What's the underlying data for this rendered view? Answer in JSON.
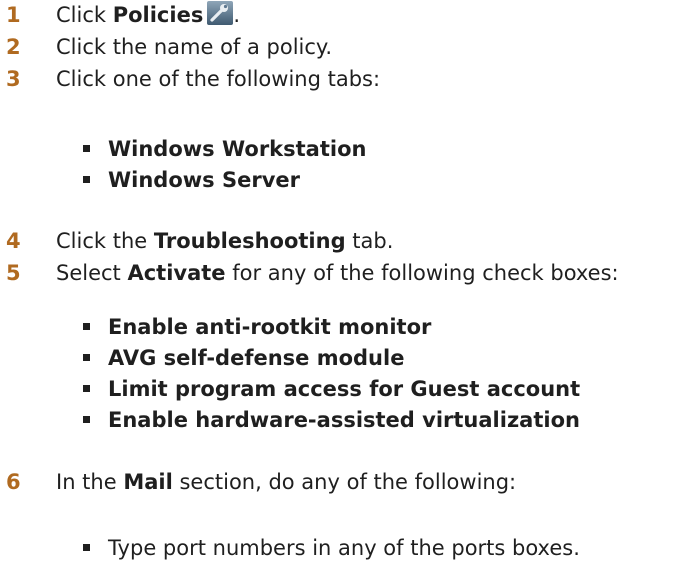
{
  "steps": [
    {
      "number": "1",
      "pre": "Click ",
      "bold": "Policies",
      "post": ".",
      "icon": "wrench-icon"
    },
    {
      "number": "2",
      "text": "Click the name of a policy."
    },
    {
      "number": "3",
      "text": "Click one of the following tabs:",
      "bullets": [
        "Windows Workstation",
        "Windows Server"
      ]
    },
    {
      "number": "4",
      "pre": "Click the ",
      "bold": "Troubleshooting",
      "post": " tab."
    },
    {
      "number": "5",
      "pre": "Select ",
      "bold": "Activate",
      "post": " for any of the following check boxes:",
      "bullets": [
        "Enable anti-rootkit monitor",
        "AVG self-defense module",
        "Limit program access for Guest account",
        "Enable hardware-assisted virtualization"
      ]
    },
    {
      "number": "6",
      "pre": "In the ",
      "bold": "Mail",
      "post": " section, do any of the following:",
      "bullets": [
        "Type port numbers in any of the ports boxes."
      ]
    }
  ],
  "colors": {
    "step_number": "#b06a20",
    "text": "#1f1f1f"
  }
}
